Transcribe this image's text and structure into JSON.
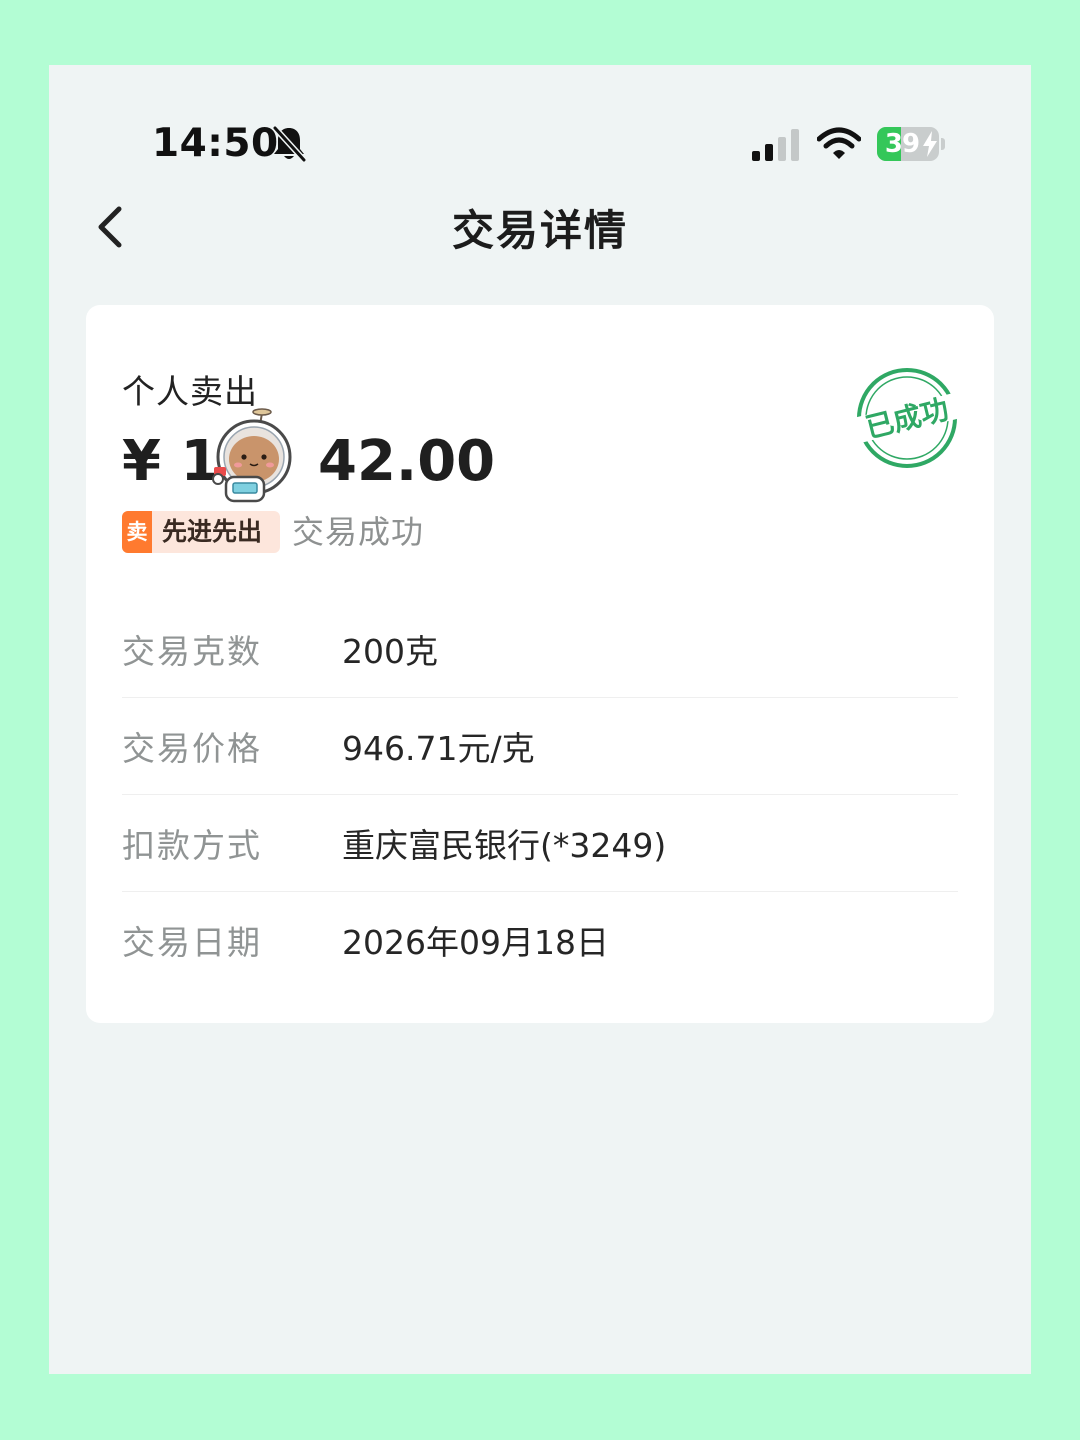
{
  "status_bar": {
    "time": "14:50",
    "battery_level": "39",
    "battery_fraction": 0.39,
    "icons": [
      "bell-off-icon",
      "signal-icon",
      "wifi-icon",
      "battery-icon",
      "charging-bolt-icon"
    ]
  },
  "nav": {
    "title": "交易详情",
    "back_icon": "chevron-left-icon"
  },
  "transaction": {
    "type_label": "个人卖出",
    "amount_prefix": "¥ 1",
    "amount_suffix": "42.00",
    "sell_badge": "卖",
    "method_tag": "先进先出",
    "status": "交易成功",
    "stamp_text": "已成功"
  },
  "details": [
    {
      "label": "交易克数",
      "value": "200克"
    },
    {
      "label": "交易价格",
      "value": "946.71元/克"
    },
    {
      "label": "扣款方式",
      "value": "重庆富民银行(*3249)"
    },
    {
      "label": "交易日期",
      "value": "2026年09月18日"
    }
  ],
  "colors": {
    "outer_background": "#b3fdd4",
    "screen_background": "#eff4f4",
    "card_background": "#ffffff",
    "stamp_green": "#2fa864",
    "sell_orange": "#ff7a2f",
    "battery_green": "#34c759"
  }
}
